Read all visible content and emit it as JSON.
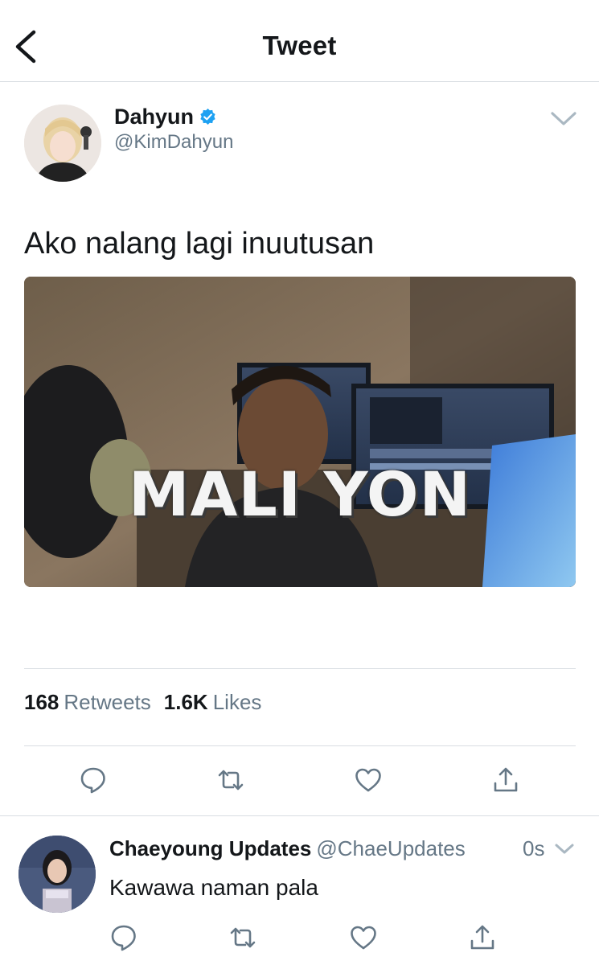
{
  "header": {
    "title": "Tweet"
  },
  "tweet": {
    "author_name": "Dahyun",
    "author_handle": "@KimDahyun",
    "text": "Ako nalang lagi inuutusan",
    "media_caption": "MALI YON",
    "retweets_count": "168",
    "retweets_label": "Retweets",
    "likes_count": "1.6K",
    "likes_label": "Likes"
  },
  "reply": {
    "author_name": "Chaeyoung Updates",
    "author_handle": "@ChaeUpdates",
    "time": "0s",
    "text": "Kawawa naman pala"
  },
  "colors": {
    "text": "#14171a",
    "secondary": "#657786",
    "verified": "#1da1f2",
    "divider": "#d8dde2"
  },
  "icons": [
    "back-chevron-icon",
    "verified-badge-icon",
    "chevron-down-icon",
    "reply-icon",
    "retweet-icon",
    "like-icon",
    "share-icon"
  ]
}
